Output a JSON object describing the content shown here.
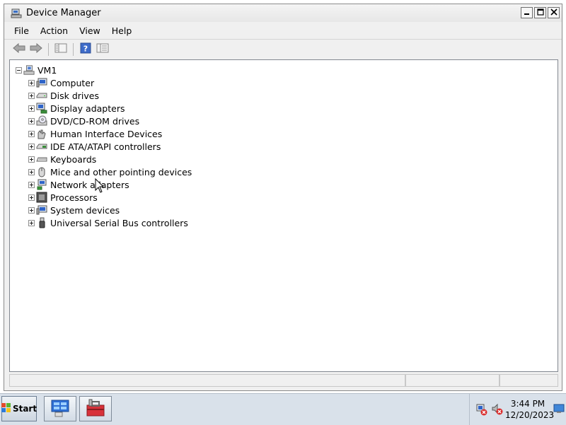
{
  "window": {
    "title": "Device Manager",
    "caption_buttons": [
      "minimize-icon",
      "maximize-icon",
      "close-icon"
    ]
  },
  "menu": [
    "File",
    "Action",
    "View",
    "Help"
  ],
  "toolbar": {
    "buttons": [
      "back-arrow-icon",
      "forward-arrow-icon",
      "show-hide-console-tree-icon",
      "help-icon",
      "properties-icon"
    ]
  },
  "tree": {
    "root": "VM1",
    "items": [
      {
        "label": "Computer",
        "icon": "computer-icon"
      },
      {
        "label": "Disk drives",
        "icon": "disk-drive-icon"
      },
      {
        "label": "Display adapters",
        "icon": "display-adapter-icon"
      },
      {
        "label": "DVD/CD-ROM drives",
        "icon": "dvd-drive-icon"
      },
      {
        "label": "Human Interface Devices",
        "icon": "hid-icon"
      },
      {
        "label": "IDE ATA/ATAPI controllers",
        "icon": "ide-controller-icon"
      },
      {
        "label": "Keyboards",
        "icon": "keyboard-icon"
      },
      {
        "label": "Mice and other pointing devices",
        "icon": "mouse-icon"
      },
      {
        "label": "Network adapters",
        "icon": "network-adapter-icon"
      },
      {
        "label": "Processors",
        "icon": "processor-icon"
      },
      {
        "label": "System devices",
        "icon": "system-devices-icon"
      },
      {
        "label": "Universal Serial Bus controllers",
        "icon": "usb-icon"
      }
    ]
  },
  "taskbar": {
    "start_label": "Start",
    "tasks": [
      "server-manager-icon",
      "toolbox-icon"
    ],
    "tray_icons": [
      "network-disconnected-icon",
      "speaker-muted-icon"
    ],
    "time": "3:44 PM",
    "date": "12/20/2023"
  }
}
